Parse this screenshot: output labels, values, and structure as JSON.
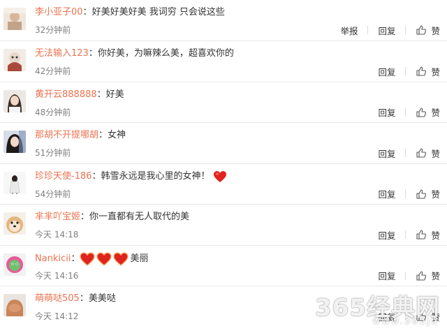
{
  "actions": {
    "report": "举报",
    "reply": "回复",
    "like": "赞"
  },
  "comments": [
    {
      "user": "李小亚子00",
      "text": "好美好美好美 我词穷 只会说这些",
      "time": "32分钟前",
      "report": true
    },
    {
      "user": "无法输入123",
      "text": "你好美，为嘛辣么美，超喜欢你的",
      "time": "42分钟前"
    },
    {
      "user": "黄开云888888",
      "text": "好美",
      "time": "48分钟前"
    },
    {
      "user": "那胡不开提哪胡",
      "text": "女神",
      "time": "51分钟前"
    },
    {
      "user": "珍珍天使-186",
      "text": "韩雪永远是我心里的女神！",
      "time": "54分钟前",
      "emoji": "heart"
    },
    {
      "user": "芈芈吖宝姬",
      "text": "你一直都有无人取代的美",
      "time": "今天 14:18"
    },
    {
      "user": "Nankicii",
      "text": "美丽",
      "time": "今天 14:16",
      "emoji": "hearts-3"
    },
    {
      "user": "萌萌哒505",
      "text": "美美哒",
      "time": "今天 14:12"
    }
  ],
  "watermark": {
    "logo": "365经典网",
    "url": "www.365jd"
  },
  "colors": {
    "username": "#eb7350",
    "text": "#333333",
    "time": "#808080",
    "heart": "#e0231c"
  }
}
